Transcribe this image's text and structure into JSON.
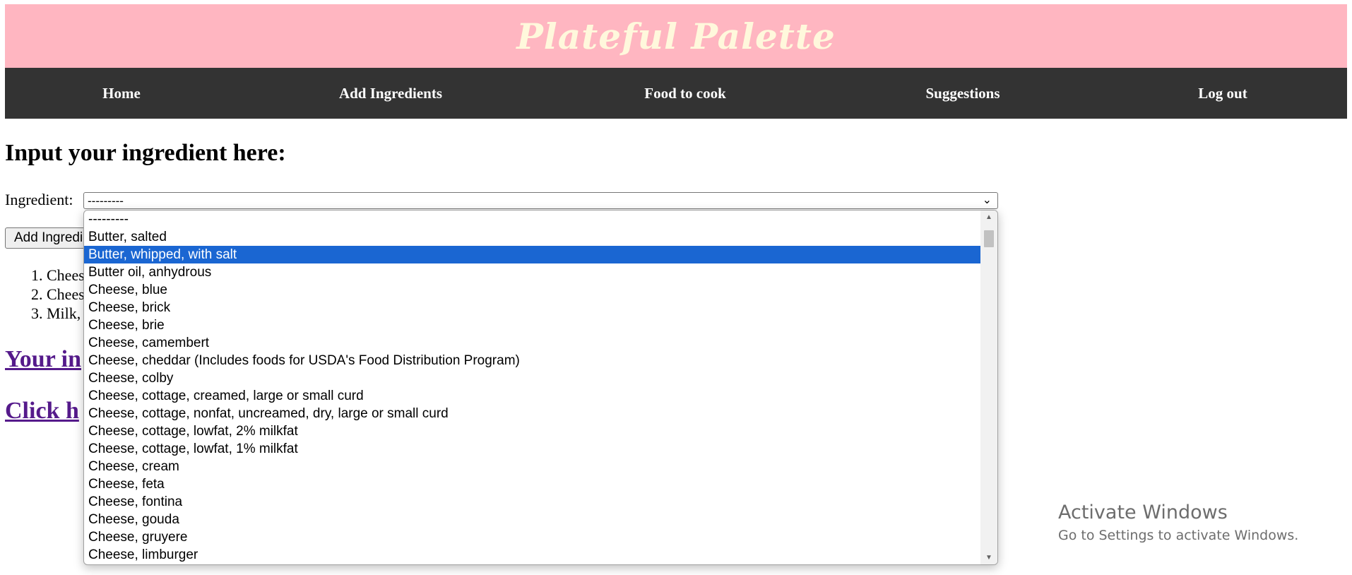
{
  "brand": {
    "title": "Plateful Palette",
    "bg": "#ffb6c1",
    "text_color": "#fff8dc"
  },
  "nav": {
    "bg": "#333333",
    "items": [
      {
        "label": "Home"
      },
      {
        "label": "Add Ingredients"
      },
      {
        "label": "Food to cook"
      },
      {
        "label": "Suggestions"
      },
      {
        "label": "Log out"
      }
    ]
  },
  "main": {
    "heading": "Input your ingredient here:",
    "ingredient_label": "Ingredient:",
    "select_value": "---------",
    "add_button_label": "Add Ingredient",
    "added_list": [
      "Chees",
      "Chees",
      "Milk,"
    ],
    "link_1": "Your in",
    "link_2": "Click h"
  },
  "dropdown": {
    "options": [
      "---------",
      "Butter, salted",
      "Butter, whipped, with salt",
      "Butter oil, anhydrous",
      "Cheese, blue",
      "Cheese, brick",
      "Cheese, brie",
      "Cheese, camembert",
      "Cheese, cheddar (Includes foods for USDA's Food Distribution Program)",
      "Cheese, colby",
      "Cheese, cottage, creamed, large or small curd",
      "Cheese, cottage, nonfat, uncreamed, dry, large or small curd",
      "Cheese, cottage, lowfat, 2% milkfat",
      "Cheese, cottage, lowfat, 1% milkfat",
      "Cheese, cream",
      "Cheese, feta",
      "Cheese, fontina",
      "Cheese, gouda",
      "Cheese, gruyere",
      "Cheese, limburger"
    ],
    "selected_index": 2,
    "highlight_color": "#1a66d2"
  },
  "windows_watermark": {
    "title": "Activate Windows",
    "subtitle": "Go to Settings to activate Windows."
  }
}
